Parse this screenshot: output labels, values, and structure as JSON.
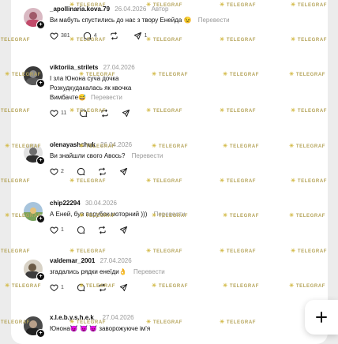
{
  "watermark_text": "TELEGRAF",
  "comments": [
    {
      "username": "_apollinaria.kova.79",
      "date": "26.04.2026",
      "author_tag": "Автор",
      "lines": [
        "Ви мабуть спустились до нас з твору Енейда 😉"
      ],
      "translate": "Перевести",
      "likes": "381",
      "replies": "4",
      "reposts": "",
      "shares": "1"
    },
    {
      "username": "viktoriia_strilets",
      "date": "27.04.2026",
      "author_tag": "",
      "lines": [
        "І зла Юнона суча дочка",
        "Розкудкудакалась як квочка",
        "Вимбачте😅"
      ],
      "translate": "Перевести",
      "likes": "11",
      "replies": "",
      "reposts": "",
      "shares": ""
    },
    {
      "username": "olenayashchuk",
      "date": "26.04.2026",
      "author_tag": "",
      "lines": [
        "Ви знайшли свого Авось?"
      ],
      "translate": "Перевести",
      "likes": "2",
      "replies": "",
      "reposts": "",
      "shares": ""
    },
    {
      "username": "chip22294",
      "date": "30.04.2026",
      "author_tag": "",
      "lines": [
        "А Еней, був парубок моторний )))"
      ],
      "translate": "Перевести",
      "likes": "1",
      "replies": "",
      "reposts": "",
      "shares": ""
    },
    {
      "username": "valdemar_2001",
      "date": "27.04.2026",
      "author_tag": "",
      "lines": [
        "згадались рядки енеїди👌"
      ],
      "translate": "Перевести",
      "likes": "1",
      "replies": "",
      "reposts": "",
      "shares": ""
    },
    {
      "username": "x.l.e.b.y.s.h.e.k_",
      "date": "27.04.2026",
      "author_tag": "",
      "lines": [
        "Юнона😈 😈 😈 заворожуюче ім'я"
      ],
      "translate": "",
      "likes": "",
      "replies": "",
      "reposts": "",
      "shares": ""
    }
  ],
  "icons": {
    "like": "heart-icon",
    "reply": "comment-bubble-icon",
    "repost": "repost-icon",
    "share": "send-icon",
    "compose": "plus-icon"
  },
  "colors": {
    "background": "#ececec",
    "card": "#ffffff",
    "muted": "#999999",
    "watermark": "#b5a45a"
  }
}
